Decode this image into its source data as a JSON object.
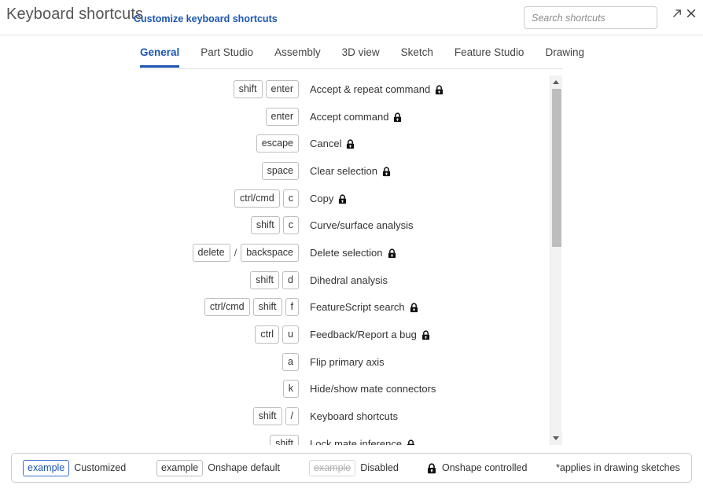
{
  "header": {
    "title": "Keyboard shortcuts",
    "customize_link": "Customize keyboard shortcuts",
    "search_placeholder": "Search shortcuts",
    "search_value": "",
    "popout_icon": "popout-arrow-icon",
    "close_icon": "close-icon"
  },
  "tabs": [
    {
      "label": "General",
      "active": true
    },
    {
      "label": "Part Studio",
      "active": false
    },
    {
      "label": "Assembly",
      "active": false
    },
    {
      "label": "3D view",
      "active": false
    },
    {
      "label": "Sketch",
      "active": false
    },
    {
      "label": "Feature Studio",
      "active": false
    },
    {
      "label": "Drawing",
      "active": false
    }
  ],
  "shortcuts": [
    {
      "keys": [
        "shift",
        "enter"
      ],
      "label": "Accept & repeat command",
      "locked": true
    },
    {
      "keys": [
        "enter"
      ],
      "label": "Accept command",
      "locked": true
    },
    {
      "keys": [
        "escape"
      ],
      "label": "Cancel",
      "locked": true
    },
    {
      "keys": [
        "space"
      ],
      "label": "Clear selection",
      "locked": true
    },
    {
      "keys": [
        "ctrl/cmd",
        "c"
      ],
      "label": "Copy",
      "locked": true
    },
    {
      "keys": [
        "shift",
        "c"
      ],
      "label": "Curve/surface analysis",
      "locked": false
    },
    {
      "keys": [
        "delete",
        "/",
        "backspace"
      ],
      "label": "Delete selection",
      "locked": true
    },
    {
      "keys": [
        "shift",
        "d"
      ],
      "label": "Dihedral analysis",
      "locked": false
    },
    {
      "keys": [
        "ctrl/cmd",
        "shift",
        "f"
      ],
      "label": "FeatureScript search",
      "locked": true
    },
    {
      "keys": [
        "ctrl",
        "u"
      ],
      "label": "Feedback/Report a bug",
      "locked": true
    },
    {
      "keys": [
        "a"
      ],
      "label": "Flip primary axis",
      "locked": false
    },
    {
      "keys": [
        "k"
      ],
      "label": "Hide/show mate connectors",
      "locked": false
    },
    {
      "keys": [
        "shift",
        "/"
      ],
      "label": "Keyboard shortcuts",
      "locked": false
    },
    {
      "keys": [
        "shift"
      ],
      "label": "Lock mate inference",
      "locked": true
    }
  ],
  "legend": {
    "customized": {
      "example": "example",
      "text": "Customized"
    },
    "onshape_default": {
      "example": "example",
      "text": "Onshape default"
    },
    "disabled": {
      "example": "example",
      "text": "Disabled"
    },
    "onshape_controlled": {
      "text": "Onshape controlled",
      "icon": "lock-icon"
    },
    "footnote": "*applies in drawing sketches"
  },
  "colors": {
    "accent": "#1b56b2",
    "text": "#333333",
    "muted": "#8c8c8c",
    "key_border": "#bdbdbd",
    "scrollbar_thumb": "#bdbdbd"
  },
  "scrollbar": {
    "up_arrow_icon": "triangle-up-icon",
    "down_arrow_icon": "triangle-down-icon"
  }
}
